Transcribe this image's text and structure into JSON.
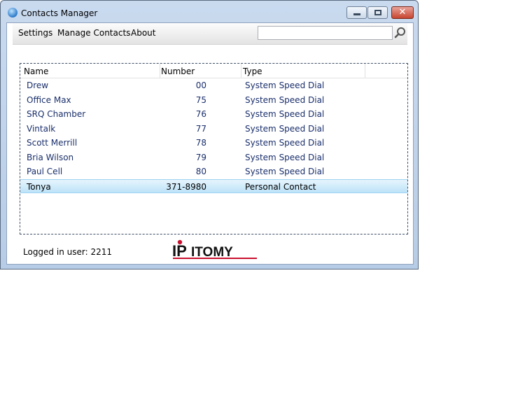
{
  "window": {
    "title": "Contacts Manager",
    "close_glyph": "✕",
    "icons": [
      "app-icon",
      "minimize-icon",
      "maximize-icon",
      "close-icon"
    ]
  },
  "menu": {
    "items": [
      {
        "label": "Settings"
      },
      {
        "label": "Manage Contacts"
      },
      {
        "label": "About"
      }
    ]
  },
  "search": {
    "value": "",
    "placeholder": "",
    "icon": "search-icon"
  },
  "table": {
    "columns": [
      "Name",
      "Number",
      "Type"
    ],
    "rows": [
      {
        "name": "Drew",
        "number": "00",
        "type": "System Speed Dial"
      },
      {
        "name": "Office Max",
        "number": "75",
        "type": "System Speed Dial"
      },
      {
        "name": "SRQ Chamber",
        "number": "76",
        "type": "System Speed Dial"
      },
      {
        "name": "Vintalk",
        "number": "77",
        "type": "System Speed Dial"
      },
      {
        "name": "Scott Merrill",
        "number": "78",
        "type": "System Speed Dial"
      },
      {
        "name": "Bria Wilson",
        "number": "79",
        "type": "System Speed Dial"
      },
      {
        "name": "Paul Cell",
        "number": "80",
        "type": "System Speed Dial"
      },
      {
        "name": "Tonya",
        "number": "371-8980",
        "type": "Personal Contact",
        "selected": true
      }
    ]
  },
  "status": {
    "logged_in": "Logged in user: 2211"
  },
  "logo": {
    "text_ip": "IP",
    "text_rest": "ITOMY"
  },
  "colors": {
    "row_text": "#1a2f6b",
    "selection": "#bde3f8",
    "logo_red": "#c8102e"
  }
}
